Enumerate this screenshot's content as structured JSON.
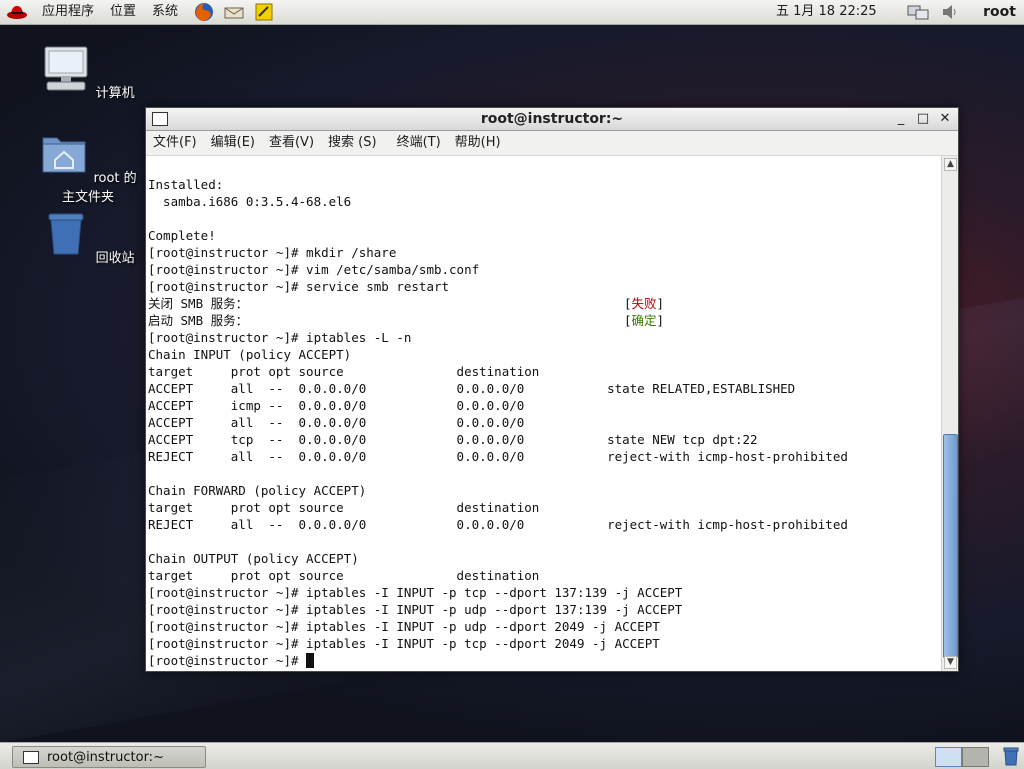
{
  "top_panel": {
    "menus": [
      "应用程序",
      "位置",
      "系统"
    ],
    "clock": "五  1月 18 22:25",
    "user": "root"
  },
  "desktop": {
    "icons": [
      {
        "label": "计算机",
        "icon": "computer-icon"
      },
      {
        "label": "root 的主文件夹",
        "icon": "home-folder-icon"
      },
      {
        "label": "回收站",
        "icon": "trash-icon"
      }
    ]
  },
  "window": {
    "title": "root@instructor:~",
    "menus": [
      "文件(F)",
      "编辑(E)",
      "查看(V)",
      "搜索 (S)",
      "终端(T)",
      "帮助(H)"
    ]
  },
  "terminal": {
    "lines": [
      "Installed:",
      "  samba.i686 0:3.5.4-68.el6",
      "",
      "Complete!",
      "[root@instructor ~]# mkdir /share",
      "[root@instructor ~]# vim /etc/samba/smb.conf",
      "[root@instructor ~]# service smb restart",
      "关闭 SMB 服务：",
      "启动 SMB 服务：",
      "[root@instructor ~]# iptables -L -n",
      "Chain INPUT (policy ACCEPT)",
      "target     prot opt source               destination",
      "ACCEPT     all  --  0.0.0.0/0            0.0.0.0/0           state RELATED,ESTABLISHED",
      "ACCEPT     icmp --  0.0.0.0/0            0.0.0.0/0",
      "ACCEPT     all  --  0.0.0.0/0            0.0.0.0/0",
      "ACCEPT     tcp  --  0.0.0.0/0            0.0.0.0/0           state NEW tcp dpt:22",
      "REJECT     all  --  0.0.0.0/0            0.0.0.0/0           reject-with icmp-host-prohibited",
      "",
      "Chain FORWARD (policy ACCEPT)",
      "target     prot opt source               destination",
      "REJECT     all  --  0.0.0.0/0            0.0.0.0/0           reject-with icmp-host-prohibited",
      "",
      "Chain OUTPUT (policy ACCEPT)",
      "target     prot opt source               destination",
      "[root@instructor ~]# iptables -I INPUT -p tcp --dport 137:139 -j ACCEPT",
      "[root@instructor ~]# iptables -I INPUT -p udp --dport 137:139 -j ACCEPT",
      "[root@instructor ~]# iptables -I INPUT -p udp --dport 2049 -j ACCEPT",
      "[root@instructor ~]# iptables -I INPUT -p tcp --dport 2049 -j ACCEPT",
      "[root@instructor ~]# "
    ],
    "status_fail": "失败",
    "status_ok": "确定",
    "status_fail_color": "#c00000",
    "status_ok_color": "#3a7d00"
  },
  "taskbar": {
    "task_label": "root@instructor:~"
  }
}
